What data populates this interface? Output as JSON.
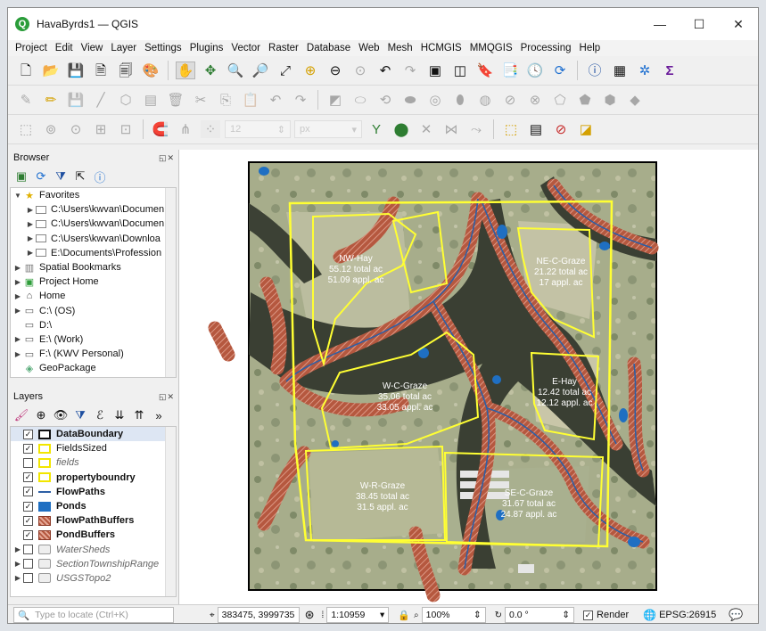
{
  "window": {
    "title": "HavaByrds1 — QGIS"
  },
  "menu": [
    "Project",
    "Edit",
    "View",
    "Layer",
    "Settings",
    "Plugins",
    "Vector",
    "Raster",
    "Database",
    "Web",
    "Mesh",
    "HCMGIS",
    "MMQGIS",
    "Processing",
    "Help"
  ],
  "toolbar3": {
    "snap_tolerance": "12",
    "snap_unit": "px"
  },
  "browser": {
    "title": "Browser",
    "items": [
      {
        "label": "Favorites",
        "level": 0,
        "arrow": "▼",
        "icon": "star-icon"
      },
      {
        "label": "C:\\Users\\kwvan\\Documen",
        "level": 1,
        "arrow": "▶",
        "icon": "folder-icon"
      },
      {
        "label": "C:\\Users\\kwvan\\Documen",
        "level": 1,
        "arrow": "▶",
        "icon": "folder-icon"
      },
      {
        "label": "C:\\Users\\kwvan\\Downloa",
        "level": 1,
        "arrow": "▶",
        "icon": "folder-icon"
      },
      {
        "label": "E:\\Documents\\Profession",
        "level": 1,
        "arrow": "▶",
        "icon": "folder-icon"
      },
      {
        "label": "Spatial Bookmarks",
        "level": 0,
        "arrow": "▶",
        "icon": "bookmark-icon"
      },
      {
        "label": "Project Home",
        "level": 0,
        "arrow": "▶",
        "icon": "project-home-icon"
      },
      {
        "label": "Home",
        "level": 0,
        "arrow": "▶",
        "icon": "home-icon"
      },
      {
        "label": "C:\\ (OS)",
        "level": 0,
        "arrow": "▶",
        "icon": "drive-icon"
      },
      {
        "label": "D:\\",
        "level": 0,
        "arrow": "",
        "icon": "drive-icon"
      },
      {
        "label": "E:\\ (Work)",
        "level": 0,
        "arrow": "▶",
        "icon": "drive-icon"
      },
      {
        "label": "F:\\ (KWV Personal)",
        "level": 0,
        "arrow": "▶",
        "icon": "drive-icon"
      },
      {
        "label": "GeoPackage",
        "level": 0,
        "arrow": "",
        "icon": "geopackage-icon"
      }
    ]
  },
  "layers": {
    "title": "Layers",
    "items": [
      {
        "label": "DataBoundary",
        "checked": true,
        "style": "b",
        "symbol": "box-black"
      },
      {
        "label": "FieldsSized",
        "checked": true,
        "style": "",
        "symbol": "box-yellow"
      },
      {
        "label": "fields",
        "checked": false,
        "style": "i",
        "symbol": "box-yellow"
      },
      {
        "label": "propertyboundry",
        "checked": true,
        "style": "b",
        "symbol": "box-yellow"
      },
      {
        "label": "FlowPaths",
        "checked": true,
        "style": "b",
        "symbol": "line-blue"
      },
      {
        "label": "Ponds",
        "checked": true,
        "style": "b",
        "symbol": "fill-blue"
      },
      {
        "label": "FlowPathBuffers",
        "checked": true,
        "style": "b",
        "symbol": "hatch-red"
      },
      {
        "label": "PondBuffers",
        "checked": true,
        "style": "b",
        "symbol": "hatch-red"
      },
      {
        "label": "WaterSheds",
        "checked": false,
        "style": "i",
        "symbol": "group"
      },
      {
        "label": "SectionTownshipRange",
        "checked": false,
        "style": "i",
        "symbol": "group"
      },
      {
        "label": "USGSTopo2",
        "checked": false,
        "style": "i",
        "symbol": "group"
      }
    ]
  },
  "map": {
    "fields": [
      {
        "name": "NW-Hay",
        "total": "55.12 total ac",
        "appl": "51.09 appl. ac"
      },
      {
        "name": "NE-C-Graze",
        "total": "21.22 total ac",
        "appl": "17 appl. ac"
      },
      {
        "name": "W-C-Graze",
        "total": "35.06 total ac",
        "appl": "33.05 appl. ac"
      },
      {
        "name": "E-Hay",
        "total": "12.42 total ac",
        "appl": "12.12 appl. ac"
      },
      {
        "name": "W-R-Graze",
        "total": "38.45 total ac",
        "appl": "31.5 appl. ac"
      },
      {
        "name": "SE-C-Graze",
        "total": "31.67 total ac",
        "appl": "24.87 appl. ac"
      }
    ]
  },
  "status": {
    "locate_placeholder": "Type to locate (Ctrl+K)",
    "coordinate": "383475, 3999735",
    "scale": "1:10959",
    "magnifier": "100%",
    "rotation": "0.0 °",
    "render_label": "Render",
    "crs": "EPSG:26915"
  }
}
